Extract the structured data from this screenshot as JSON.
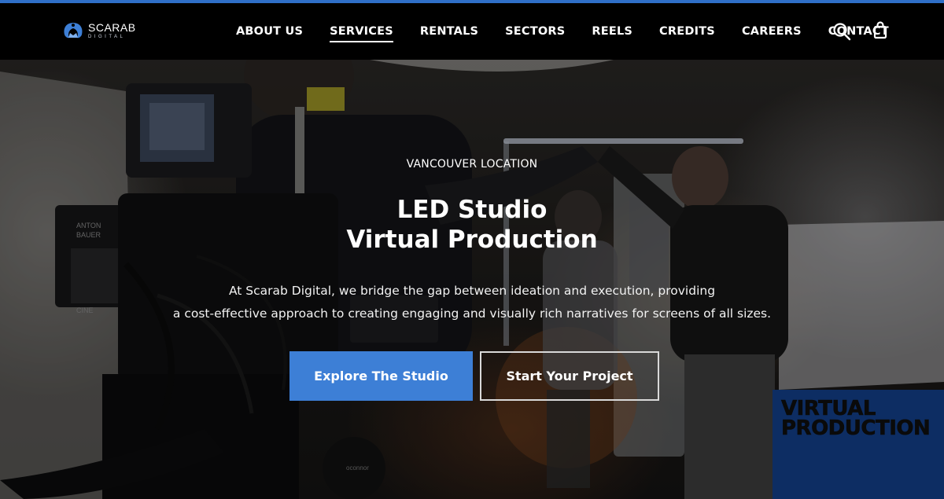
{
  "brand": {
    "name": "SCARAB",
    "sub": "DIGITAL",
    "accent": "#3d7fd6"
  },
  "nav": {
    "items": [
      {
        "label": "ABOUT US",
        "active": false
      },
      {
        "label": "SERVICES",
        "active": true
      },
      {
        "label": "RENTALS",
        "active": false
      },
      {
        "label": "SECTORS",
        "active": false
      },
      {
        "label": "REELS",
        "active": false
      },
      {
        "label": "CREDITS",
        "active": false
      },
      {
        "label": "CAREERS",
        "active": false
      },
      {
        "label": "CONTACT",
        "active": false
      }
    ],
    "icons": [
      "search-icon",
      "shopping-bag-icon"
    ]
  },
  "hero": {
    "eyebrow": "VANCOUVER LOCATION",
    "title_line1": "LED Studio",
    "title_line2": "Virtual Production",
    "desc_line1": "At Scarab Digital, we bridge the gap between ideation and execution, providing",
    "desc_line2": "a cost-effective approach to creating engaging and visually rich narratives for screens of all sizes.",
    "primary_button": "Explore The Studio",
    "secondary_button": "Start Your Project",
    "badge_line1": "VIRTUAL",
    "badge_line2": "PRODUCTION"
  },
  "camera_labels": {
    "brand1": "ANTON",
    "brand2": "BAUER",
    "tag": "CINE",
    "base": "oconnor"
  }
}
